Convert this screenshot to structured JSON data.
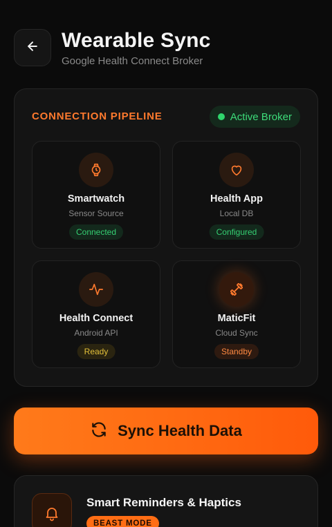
{
  "header": {
    "title": "Wearable Sync",
    "subtitle": "Google Health Connect Broker",
    "back_icon": "arrow-left-icon"
  },
  "pipeline": {
    "heading": "CONNECTION PIPELINE",
    "broker_status": "Active Broker",
    "accent_color": "#ff7a2e",
    "nodes": [
      {
        "name": "Smartwatch",
        "sub": "Sensor Source",
        "status": "Connected",
        "icon": "watch-icon"
      },
      {
        "name": "Health App",
        "sub": "Local DB",
        "status": "Configured",
        "icon": "heart-icon"
      },
      {
        "name": "Health Connect",
        "sub": "Android API",
        "status": "Ready",
        "icon": "pulse-icon"
      },
      {
        "name": "MaticFit",
        "sub": "Cloud Sync",
        "status": "Standby",
        "icon": "dumbbell-icon"
      }
    ]
  },
  "sync": {
    "label": "Sync Health Data",
    "icon": "refresh-icon"
  },
  "reminders": {
    "title": "Smart Reminders & Haptics",
    "badge": "BEAST MODE",
    "icon": "bell-icon"
  }
}
